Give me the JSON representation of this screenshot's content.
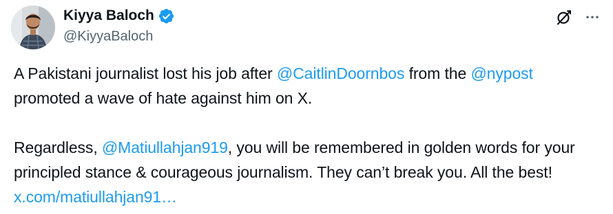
{
  "author": {
    "display_name": "Kiyya Baloch",
    "handle": "@KiyyaBaloch",
    "verified_icon": "verified-badge-icon",
    "avatar_icon": "avatar"
  },
  "actions": {
    "grok_icon": "grok-icon",
    "more_icon": "more-horizontal-icon"
  },
  "body": {
    "p1": {
      "t1": "A Pakistani journalist lost his job after ",
      "mention1": "@CaitlinDoornbos",
      "t2": " from the ",
      "mention2": "@nypost",
      "t3": " promoted a wave of hate against him on X."
    },
    "p2": {
      "t1": "Regardless, ",
      "mention1": "@Matiullahjan919",
      "t2": ", you will be remembered in golden words for your principled stance & courageous journalism. They can’t break you. All the best! ",
      "link": "x.com/matiullahjan91…"
    }
  },
  "colors": {
    "text": "#0f1419",
    "secondary": "#536471",
    "link": "#1d9bf0",
    "verified": "#1d9bf0"
  }
}
